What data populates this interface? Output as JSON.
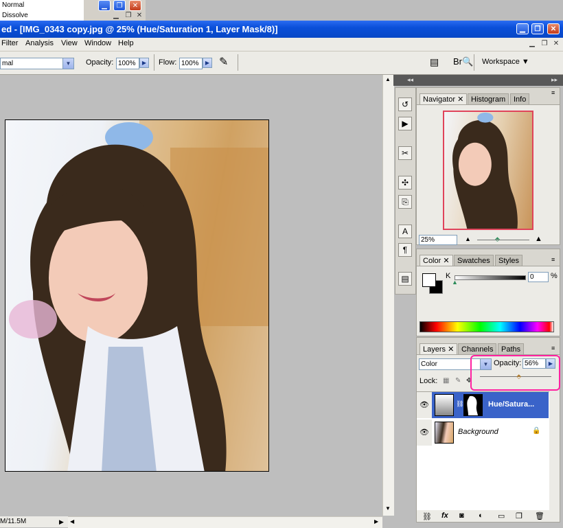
{
  "blend_menu": {
    "items": [
      "Normal",
      "Dissolve"
    ]
  },
  "title": "ed - [IMG_0343 copy.jpg @ 25% (Hue/Saturation 1, Layer Mask/8)]",
  "menu": [
    "Filter",
    "Analysis",
    "View",
    "Window",
    "Help"
  ],
  "options": {
    "mode": "mal",
    "opacity_label": "Opacity:",
    "opacity_value": "100%",
    "flow_label": "Flow:",
    "flow_value": "100%",
    "workspace": "Workspace"
  },
  "status": "M/11.5M",
  "navigator": {
    "tabs": [
      "Navigator",
      "Histogram",
      "Info"
    ],
    "zoom": "25%"
  },
  "color_panel": {
    "tabs": [
      "Color",
      "Swatches",
      "Styles"
    ],
    "channel": "K",
    "value": "0",
    "unit": "%"
  },
  "layers_panel": {
    "tabs": [
      "Layers",
      "Channels",
      "Paths"
    ],
    "blend_mode": "Color",
    "opacity_label": "Opacity:",
    "opacity_value": "56%",
    "opacity_fraction": 0.56,
    "lock_label": "Lock:",
    "layers": [
      {
        "name": "Hue/Satura...",
        "selected": true
      },
      {
        "name": "Background",
        "selected": false
      }
    ]
  },
  "icons": {
    "dock": [
      "history-icon",
      "actions-icon",
      "tools-icon",
      "brushes-icon",
      "clone-source-icon",
      "character-icon",
      "paragraph-icon",
      "layer-comps-icon"
    ],
    "layer_footer": [
      "link-icon",
      "fx-icon",
      "mask-icon",
      "adjustment-icon",
      "group-icon",
      "new-layer-icon",
      "trash-icon"
    ]
  },
  "colors": {
    "highlight": "#ff21a0",
    "title_bar": "#0a4fd9",
    "selected_layer": "#3a63c9"
  }
}
